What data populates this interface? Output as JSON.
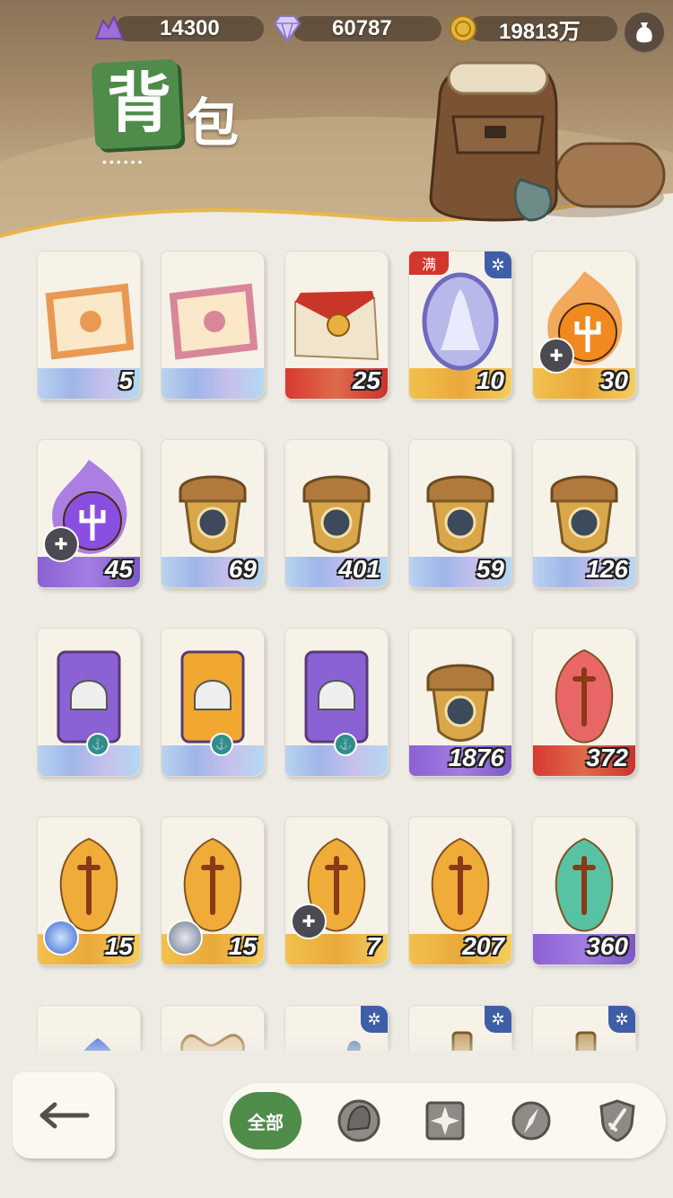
{
  "currencies": [
    {
      "icon": "purple-crystal-icon",
      "value": "14300"
    },
    {
      "icon": "diamond-icon",
      "value": "60787"
    },
    {
      "icon": "gold-coin-icon",
      "value": "19813万"
    }
  ],
  "title": {
    "char1": "背",
    "char2": "包",
    "dots": "••••••"
  },
  "items": [
    {
      "icon": "orange-ticket-icon",
      "count": "5",
      "strip": "blue",
      "badge": null,
      "corner": false,
      "overlay": null
    },
    {
      "icon": "pink-ticket-icon",
      "count": "",
      "strip": "blue",
      "badge": null,
      "corner": false,
      "overlay": null
    },
    {
      "icon": "red-envelope-icon",
      "count": "25",
      "strip": "red",
      "badge": null,
      "corner": false,
      "overlay": null
    },
    {
      "icon": "mirror-medal-icon",
      "count": "10",
      "strip": "gold",
      "badge": "满",
      "corner": true,
      "overlay": null
    },
    {
      "icon": "fire-trident-orb-icon",
      "count": "30",
      "strip": "gold",
      "badge": null,
      "corner": false,
      "overlay": "puzzle"
    },
    {
      "icon": "purple-trident-orb-icon",
      "count": "45",
      "strip": "purple",
      "badge": null,
      "corner": false,
      "overlay": "puzzle"
    },
    {
      "icon": "acorn-eye-icon",
      "count": "69",
      "strip": "blue",
      "badge": null,
      "corner": false,
      "overlay": null
    },
    {
      "icon": "acorn-target-icon",
      "count": "401",
      "strip": "blue",
      "badge": null,
      "corner": false,
      "overlay": null
    },
    {
      "icon": "acorn-leaf-icon",
      "count": "59",
      "strip": "blue",
      "badge": null,
      "corner": false,
      "overlay": null
    },
    {
      "icon": "acorn-star-icon",
      "count": "126",
      "strip": "blue",
      "badge": null,
      "corner": false,
      "overlay": null
    },
    {
      "icon": "purple-helmet-ticket-icon",
      "count": "",
      "strip": "blue",
      "badge": null,
      "corner": false,
      "overlay": "anchor"
    },
    {
      "icon": "gold-helmet-ticket-icon",
      "count": "",
      "strip": "blue",
      "badge": null,
      "corner": false,
      "overlay": "anchor"
    },
    {
      "icon": "purple-helmet-ticket-icon",
      "count": "",
      "strip": "blue",
      "badge": null,
      "corner": false,
      "overlay": "anchor"
    },
    {
      "icon": "acorn-diamond-icon",
      "count": "1876",
      "strip": "purple",
      "badge": null,
      "corner": false,
      "overlay": null
    },
    {
      "icon": "red-key-crystal-icon",
      "count": "372",
      "strip": "red",
      "badge": null,
      "corner": false,
      "overlay": null
    },
    {
      "icon": "gold-key-crystal-icon",
      "count": "15",
      "strip": "gold",
      "badge": null,
      "corner": false,
      "overlay": "avatar-blue"
    },
    {
      "icon": "gold-key-crystal-icon",
      "count": "15",
      "strip": "gold",
      "badge": null,
      "corner": false,
      "overlay": "avatar-grey"
    },
    {
      "icon": "gold-key-crystal-icon",
      "count": "7",
      "strip": "gold",
      "badge": null,
      "corner": false,
      "overlay": "puzzle"
    },
    {
      "icon": "gold-key-crystal-icon",
      "count": "207",
      "strip": "gold",
      "badge": null,
      "corner": false,
      "overlay": null
    },
    {
      "icon": "green-key-crystal-icon",
      "count": "360",
      "strip": "purple",
      "badge": null,
      "corner": false,
      "overlay": null
    },
    {
      "icon": "blue-crystal-icon",
      "count": "",
      "strip": "blue",
      "badge": null,
      "corner": false,
      "overlay": null
    },
    {
      "icon": "bone-scroll-icon",
      "count": "",
      "strip": "blue",
      "badge": null,
      "corner": false,
      "overlay": null
    },
    {
      "icon": "pen-icon",
      "count": "",
      "strip": "blue",
      "badge": null,
      "corner": true,
      "overlay": null
    },
    {
      "icon": "potion-bottle-icon",
      "count": "",
      "strip": "blue",
      "badge": null,
      "corner": true,
      "overlay": null
    },
    {
      "icon": "potion-bottle-icon",
      "count": "",
      "strip": "blue",
      "badge": null,
      "corner": true,
      "overlay": null
    }
  ],
  "tabs": [
    {
      "name": "tab-all",
      "label": "全部",
      "icon": null,
      "active": true
    },
    {
      "name": "tab-helmet",
      "label": "",
      "icon": "helmet-icon",
      "active": false
    },
    {
      "name": "tab-shuriken",
      "label": "",
      "icon": "shuriken-icon",
      "active": false
    },
    {
      "name": "tab-compass",
      "label": "",
      "icon": "compass-icon",
      "active": false
    },
    {
      "name": "tab-shield",
      "label": "",
      "icon": "shield-sword-icon",
      "active": false
    }
  ],
  "colors": {
    "accent_green": "#4f8c4a",
    "badge_red": "#d3362b",
    "corner_blue": "#3e5ea8"
  }
}
